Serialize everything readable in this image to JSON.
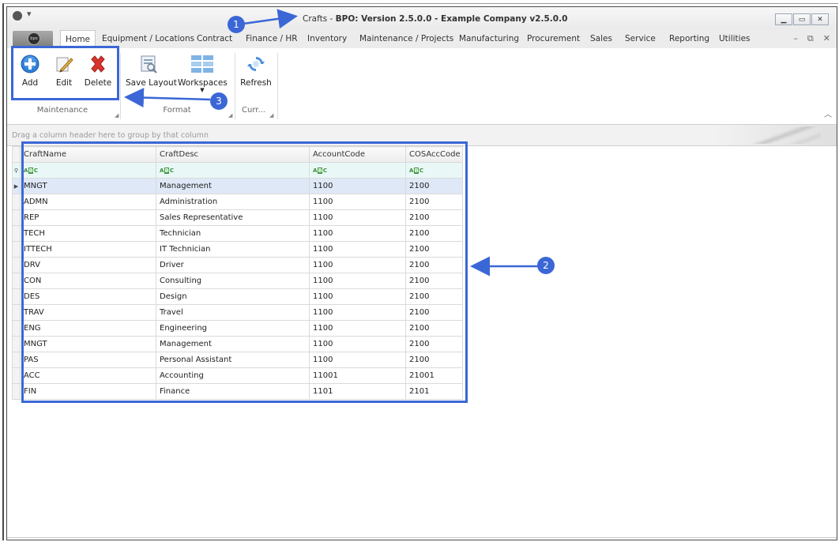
{
  "window": {
    "title_prefix": "Crafts - ",
    "title_bold": "BPO: Version 2.5.0.0 - Example Company v2.5.0.0",
    "logo_text": "bpo"
  },
  "tabs": [
    "Home",
    "Equipment / Locations",
    "Contract",
    "Finance / HR",
    "Inventory",
    "Maintenance / Projects",
    "Manufacturing",
    "Procurement",
    "Sales",
    "Service",
    "Reporting",
    "Utilities"
  ],
  "ribbon": {
    "add": "Add",
    "edit": "Edit",
    "delete": "Delete",
    "save_layout": "Save Layout",
    "workspaces": "Workspaces",
    "refresh": "Refresh",
    "group_maintenance": "Maintenance",
    "group_format": "Format",
    "group_current": "Curr..."
  },
  "grid": {
    "group_hint": "Drag a column header here to group by that column",
    "columns": [
      "CraftName",
      "CraftDesc",
      "AccountCode",
      "COSAccCode"
    ],
    "rows": [
      [
        "MNGT",
        "Management",
        "1100",
        "2100"
      ],
      [
        "ADMN",
        "Administration",
        "1100",
        "2100"
      ],
      [
        "REP",
        "Sales Representative",
        "1100",
        "2100"
      ],
      [
        "TECH",
        "Technician",
        "1100",
        "2100"
      ],
      [
        "ITTECH",
        "IT Technician",
        "1100",
        "2100"
      ],
      [
        "DRV",
        "Driver",
        "1100",
        "2100"
      ],
      [
        "CON",
        "Consulting",
        "1100",
        "2100"
      ],
      [
        "DES",
        "Design",
        "1100",
        "2100"
      ],
      [
        "TRAV",
        "Travel",
        "1100",
        "2100"
      ],
      [
        "ENG",
        "Engineering",
        "1100",
        "2100"
      ],
      [
        "MNGT",
        "Management",
        "1100",
        "2100"
      ],
      [
        "PAS",
        "Personal Assistant",
        "1100",
        "2100"
      ],
      [
        "ACC",
        "Accounting",
        "11001",
        "21001"
      ],
      [
        "FIN",
        "Finance",
        "1101",
        "2101"
      ]
    ]
  },
  "annotations": [
    "1",
    "2",
    "3"
  ],
  "colors": {
    "annotation": "#3b67d6",
    "delete_x": "#d9342b",
    "add_blue": "#2f7fd6"
  }
}
